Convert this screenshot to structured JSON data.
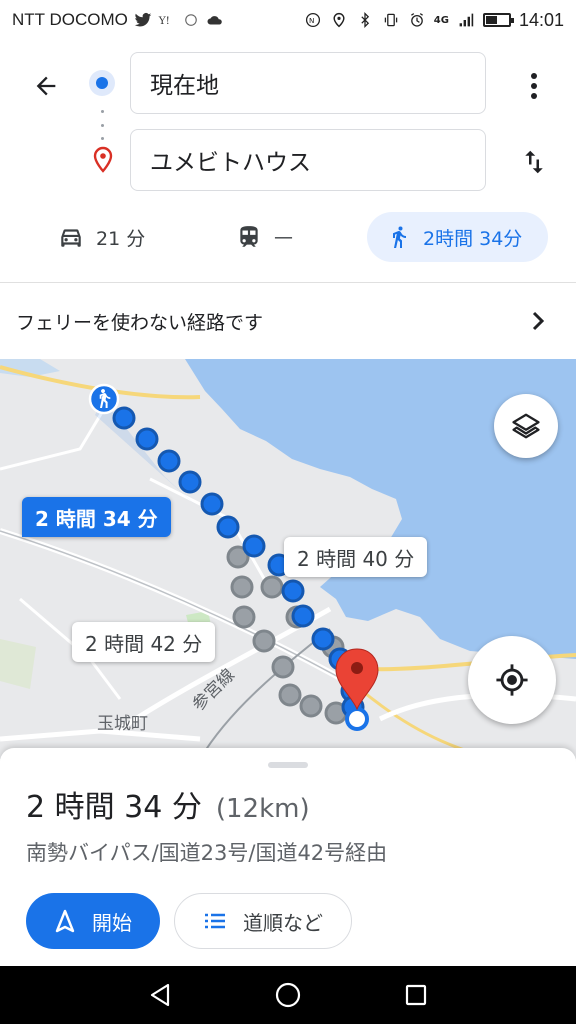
{
  "status_bar": {
    "carrier": "NTT DOCOMO",
    "network": "4G",
    "time": "14:01",
    "battery_level": 0.45
  },
  "directions": {
    "origin": "現在地",
    "destination": "ユメビトハウス",
    "icons": {
      "back": "arrow-left-icon",
      "more": "more-vert-icon",
      "swap": "swap-vert-icon"
    }
  },
  "modes": {
    "car": "21 分",
    "transit": "—",
    "walk": "2時間 34分",
    "selected": "walk"
  },
  "notice": {
    "text": "フェリーを使わない経路です"
  },
  "map": {
    "primary_route_label": "2 時間 34 分",
    "alt_route_label_1": "2 時間 40 分",
    "alt_route_label_2": "2 時間 42 分",
    "town_label": "玉城町",
    "rail_label": "参宮線",
    "colors": {
      "water": "#9dc4f0",
      "land": "#e8e9eb",
      "route": "#1a73e8",
      "alt_route": "#9aa0a6",
      "destination_pin": "#ea4335"
    }
  },
  "summary": {
    "duration": "2 時間 34 分",
    "distance": "(12km)",
    "via": "南勢バイパス/国道23号/国道42号経由",
    "start_label": "開始",
    "steps_label": "道順など"
  },
  "accent_color": "#1a73e8"
}
